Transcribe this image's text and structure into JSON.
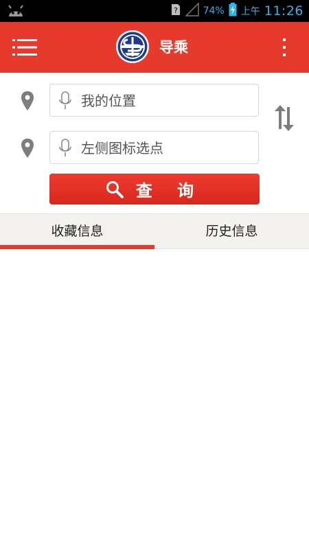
{
  "status_bar": {
    "signal_percent": "74%",
    "ampm": "上午",
    "time": "11:26",
    "icons": [
      "android-icon",
      "sim-unknown-icon",
      "signal-icon",
      "battery-charging-icon"
    ]
  },
  "header": {
    "title": "导乘",
    "icons": [
      "menu-icon",
      "logo",
      "more-vert-icon"
    ]
  },
  "search": {
    "origin_placeholder": "我的位置",
    "destination_placeholder": "左侧图标选点",
    "query_label": "查 询"
  },
  "tabs": [
    {
      "label": "收藏信息",
      "active": true
    },
    {
      "label": "历史信息",
      "active": false
    }
  ],
  "colors": {
    "accent": "#e53a2c",
    "status_text": "#2fb4e8"
  }
}
